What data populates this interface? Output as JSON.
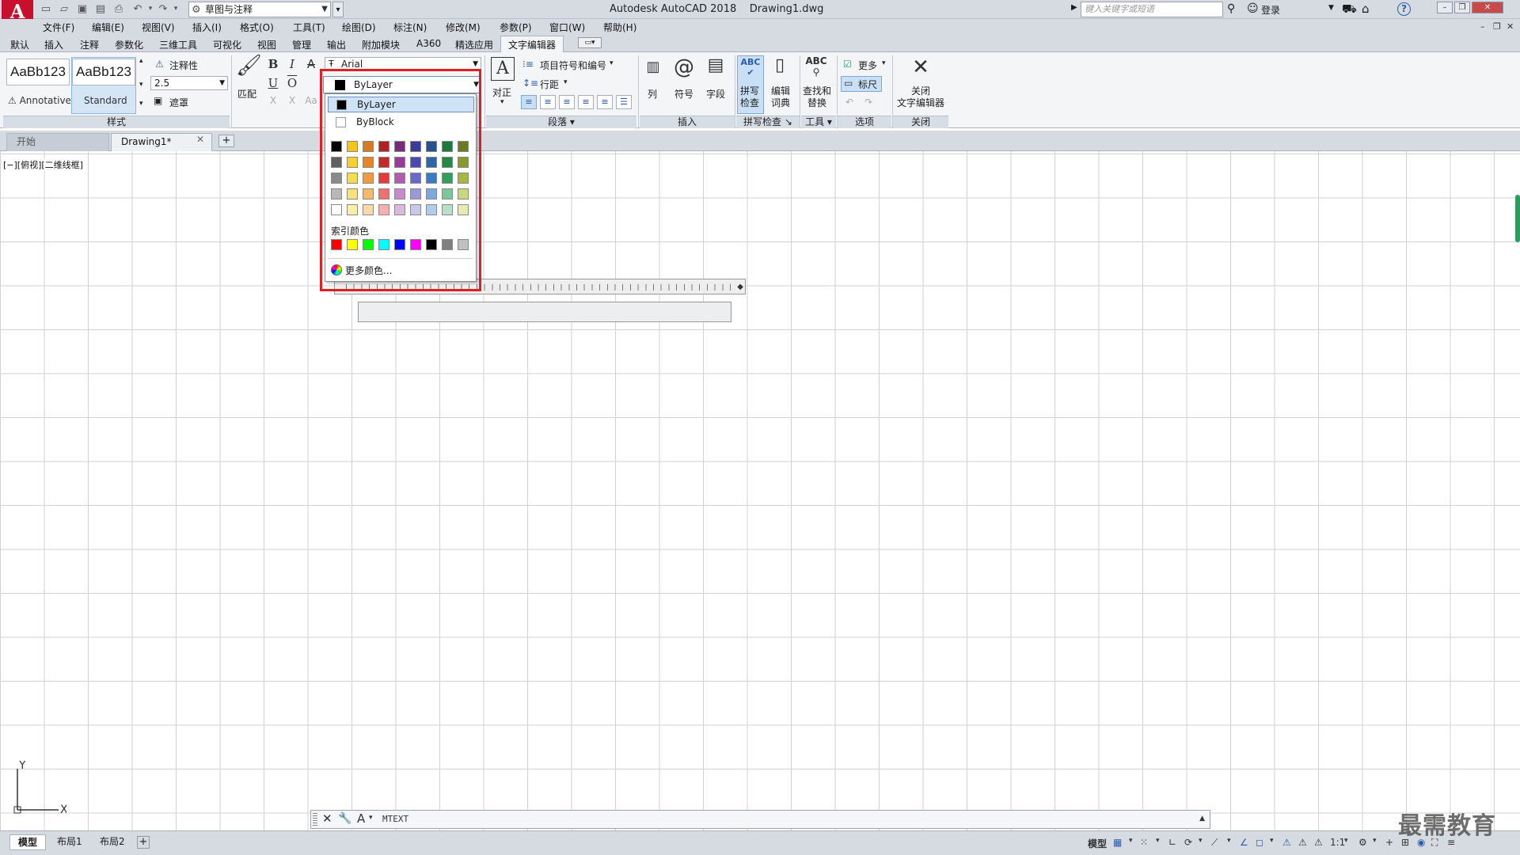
{
  "titlebar": {
    "title": "Autodesk AutoCAD 2018    Drawing1.dwg",
    "workspace": "草图与注释",
    "search_placeholder": "键入关键字或短语",
    "login": "登录",
    "logo": "A"
  },
  "menu": [
    "文件(F)",
    "编辑(E)",
    "视图(V)",
    "插入(I)",
    "格式(O)",
    "工具(T)",
    "绘图(D)",
    "标注(N)",
    "修改(M)",
    "参数(P)",
    "窗口(W)",
    "帮助(H)"
  ],
  "ribbon_tabs": [
    "默认",
    "插入",
    "注释",
    "参数化",
    "三维工具",
    "可视化",
    "视图",
    "管理",
    "输出",
    "附加模块",
    "A360",
    "精选应用",
    "文字编辑器"
  ],
  "ribbon": {
    "style": {
      "annotative_sample": "AaBb123",
      "annotative_label": "Annotative",
      "standard_sample": "AaBb123",
      "standard_label": "Standard",
      "annotative_toggle": "注释性",
      "text_height": "2.5",
      "mask": "遮罩",
      "panel_title": "样式"
    },
    "format": {
      "match": "匹配",
      "font": "Arial",
      "bold": "B",
      "italic": "I",
      "underline": "U",
      "overline": "O",
      "strike": "A",
      "superscript": "X",
      "subscript": "X",
      "case": "Aa"
    },
    "paragraph": {
      "justify": "对正",
      "bullets": "项目符号和编号",
      "line_spacing": "行距",
      "panel_title": "段落"
    },
    "insert": {
      "columns": "列",
      "symbol": "符号",
      "field": "字段",
      "panel_title": "插入"
    },
    "spell": {
      "spell_check": "拼写\n检查",
      "edit_dict": "编辑\n词典",
      "panel_title": "拼写检查"
    },
    "tools": {
      "find_replace": "查找和\n替换",
      "panel_title": "工具"
    },
    "options": {
      "more": "更多",
      "ruler": "标尺",
      "panel_title": "选项"
    },
    "close": {
      "close_editor": "关闭\n文字编辑器",
      "panel_title": "关闭"
    }
  },
  "color_dropdown": {
    "selected": "ByLayer",
    "bylayer": "ByLayer",
    "byblock": "ByBlock",
    "index_label": "索引颜色",
    "more_colors": "更多颜色...",
    "grid": [
      [
        "#000000",
        "#f5c518",
        "#d97a21",
        "#b22222",
        "#7a2a7a",
        "#3a3a9a",
        "#2a4f8f",
        "#1e7a3a",
        "#6b7a1e"
      ],
      [
        "#606060",
        "#f3d22e",
        "#e8832a",
        "#c42828",
        "#9a3a9a",
        "#4a4ab2",
        "#2e64a8",
        "#238a45",
        "#8a9a2a"
      ],
      [
        "#8a8a8a",
        "#f5dc4a",
        "#f39a3a",
        "#e83a3a",
        "#b25ab2",
        "#6a6ac8",
        "#3a7ac8",
        "#2ea05a",
        "#a8b83a"
      ],
      [
        "#b8b8b8",
        "#f7e37a",
        "#f7b86a",
        "#f07070",
        "#c88ac8",
        "#9a9ad8",
        "#7aa8e0",
        "#7ac89a",
        "#c8d87a"
      ],
      [
        "#ffffff",
        "#faeea8",
        "#fad8a8",
        "#f7b0b0",
        "#dcb8dc",
        "#c8c8ea",
        "#b0cdee",
        "#b8e0c8",
        "#e4ecb0"
      ]
    ],
    "index_colors": [
      "#ff0000",
      "#ffff00",
      "#00ff00",
      "#00ffff",
      "#0000ff",
      "#ff00ff",
      "#000000",
      "#808080",
      "#c0c0c0"
    ]
  },
  "doc_tabs": {
    "start": "开始",
    "drawing": "Drawing1*"
  },
  "viewport_label": "[−][俯视][二维线框]",
  "ucs": {
    "x": "X",
    "y": "Y"
  },
  "cmdline": {
    "text": "MTEXT"
  },
  "layout_tabs": [
    "模型",
    "布局1",
    "布局2"
  ],
  "status": {
    "model": "模型",
    "scale": "1:1"
  },
  "watermark": "最需教育"
}
